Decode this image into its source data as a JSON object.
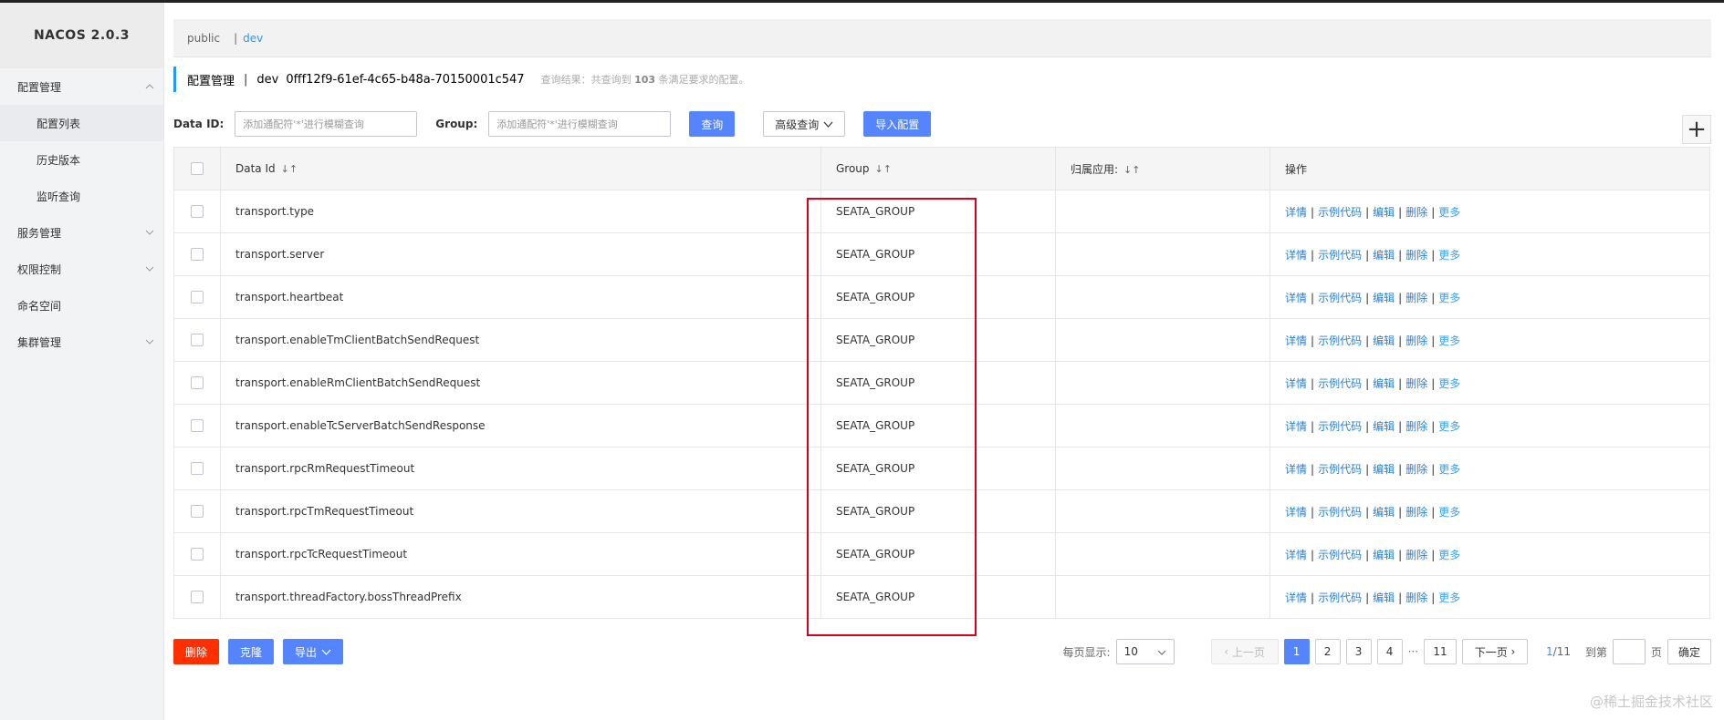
{
  "app": {
    "brand": "NACOS 2.0.3"
  },
  "sidebar": {
    "items": [
      {
        "label": "配置管理",
        "expanded": true,
        "children": [
          {
            "label": "配置列表",
            "active": true
          },
          {
            "label": "历史版本"
          },
          {
            "label": "监听查询"
          }
        ]
      },
      {
        "label": "服务管理"
      },
      {
        "label": "权限控制"
      },
      {
        "label": "命名空间"
      },
      {
        "label": "集群管理"
      }
    ]
  },
  "namespaces": {
    "items": [
      "public",
      "dev"
    ],
    "active": "dev",
    "separator": "|"
  },
  "header": {
    "title": "配置管理",
    "pipe": "|",
    "namespace_name": "dev",
    "namespace_id": "0fff12f9-61ef-4c65-b48a-70150001c547",
    "result_prefix": "查询结果：共查询到",
    "result_count": "103",
    "result_suffix": "条满足要求的配置。"
  },
  "search": {
    "dataid_label": "Data ID:",
    "dataid_placeholder": "添加通配符'*'进行模糊查询",
    "group_label": "Group:",
    "group_placeholder": "添加通配符'*'进行模糊查询",
    "query_button": "查询",
    "advanced_button": "高级查询",
    "import_button": "导入配置",
    "add_symbol": "+"
  },
  "table": {
    "columns": [
      "Data Id",
      "Group",
      "归属应用:",
      "操作"
    ],
    "rows": [
      {
        "data_id": "transport.type",
        "group": "SEATA_GROUP",
        "app": ""
      },
      {
        "data_id": "transport.server",
        "group": "SEATA_GROUP",
        "app": ""
      },
      {
        "data_id": "transport.heartbeat",
        "group": "SEATA_GROUP",
        "app": ""
      },
      {
        "data_id": "transport.enableTmClientBatchSendRequest",
        "group": "SEATA_GROUP",
        "app": ""
      },
      {
        "data_id": "transport.enableRmClientBatchSendRequest",
        "group": "SEATA_GROUP",
        "app": ""
      },
      {
        "data_id": "transport.enableTcServerBatchSendResponse",
        "group": "SEATA_GROUP",
        "app": ""
      },
      {
        "data_id": "transport.rpcRmRequestTimeout",
        "group": "SEATA_GROUP",
        "app": ""
      },
      {
        "data_id": "transport.rpcTmRequestTimeout",
        "group": "SEATA_GROUP",
        "app": ""
      },
      {
        "data_id": "transport.rpcTcRequestTimeout",
        "group": "SEATA_GROUP",
        "app": ""
      },
      {
        "data_id": "transport.threadFactory.bossThreadPrefix",
        "group": "SEATA_GROUP",
        "app": ""
      }
    ],
    "actions": [
      "详情",
      "示例代码",
      "编辑",
      "删除",
      "更多"
    ],
    "action_separator": "|"
  },
  "footer": {
    "delete_button": "删除",
    "clone_button": "克隆",
    "export_button": "导出",
    "page_size_label": "每页显示:",
    "page_size": "10",
    "prev_label": "上一页",
    "pages": [
      "1",
      "2",
      "3",
      "4"
    ],
    "ellipsis": "···",
    "last_page": "11",
    "next_label": "下一页",
    "current_page": "1",
    "total_pages": "/11",
    "goto_label": "到第",
    "page_unit": "页",
    "confirm_button": "确定"
  },
  "watermark": "@稀土掘金技术社区",
  "colors": {
    "primary": "#5584ff",
    "link": "#2a7fd4",
    "danger": "#ff3000",
    "highlight_box": "#d9001b"
  }
}
